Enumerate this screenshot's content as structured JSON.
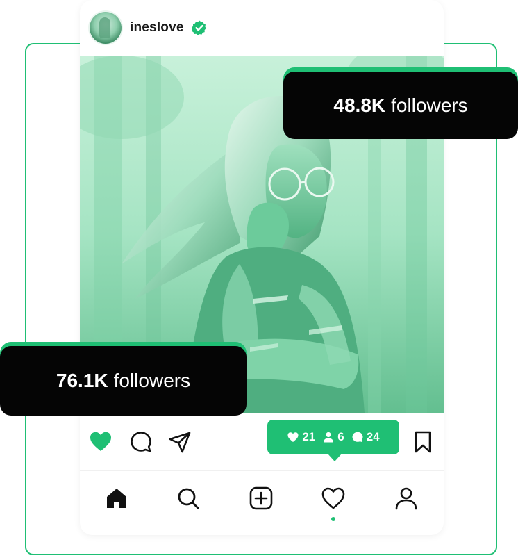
{
  "profile": {
    "username": "ineslove",
    "verified": true
  },
  "badges": {
    "right": {
      "count": "48.8K",
      "label": "followers"
    },
    "left": {
      "count": "76.1K",
      "label": "followers"
    }
  },
  "stats": {
    "likes": "21",
    "followers": "6",
    "comments": "24"
  },
  "actions": [
    "heart-icon",
    "comment-icon",
    "send-icon",
    "bookmark-icon"
  ],
  "nav": [
    "home-icon",
    "search-icon",
    "add-icon",
    "heart-icon",
    "profile-icon"
  ],
  "colors": {
    "accent": "#1fbf74",
    "badge_bg": "#050505",
    "text": "#1a1a1a"
  }
}
